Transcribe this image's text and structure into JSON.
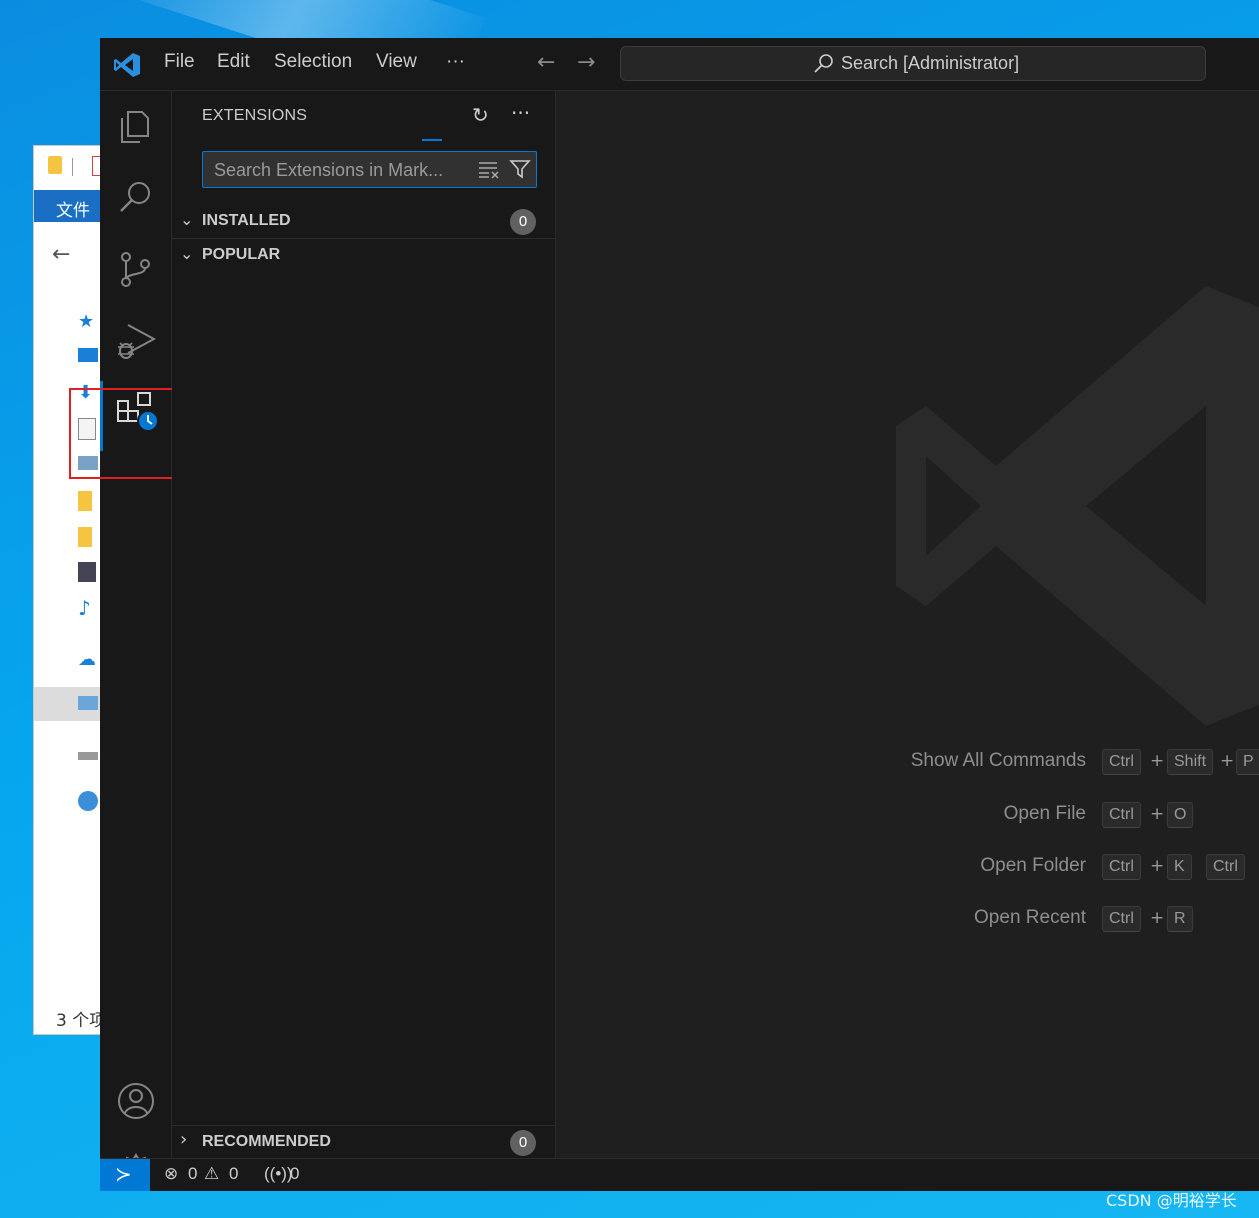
{
  "explorer": {
    "ribbon_tab": "文件",
    "status": "3 个项"
  },
  "titlebar": {
    "menu": [
      "File",
      "Edit",
      "Selection",
      "View",
      "···"
    ],
    "search": "Search [Administrator]"
  },
  "sidebar": {
    "title": "EXTENSIONS",
    "search_placeholder": "Search Extensions in Mark...",
    "sections": {
      "installed": {
        "label": "INSTALLED",
        "count": "0"
      },
      "popular": {
        "label": "POPULAR"
      },
      "recommended": {
        "label": "RECOMMENDED",
        "count": "0"
      }
    }
  },
  "editor": {
    "shortcuts": [
      {
        "label": "Show All Commands",
        "keys": [
          "Ctrl",
          "Shift",
          "P"
        ]
      },
      {
        "label": "Open File",
        "keys": [
          "Ctrl",
          "O"
        ]
      },
      {
        "label": "Open Folder",
        "keys": [
          "Ctrl",
          "K",
          "Ctrl"
        ]
      },
      {
        "label": "Open Recent",
        "keys": [
          "Ctrl",
          "R"
        ]
      }
    ]
  },
  "statusbar": {
    "errors": "0",
    "warnings": "0",
    "ports": "0"
  },
  "watermark": "CSDN @明裕学长",
  "colors": {
    "accent": "#0078d4",
    "highlight": "#e02020"
  }
}
